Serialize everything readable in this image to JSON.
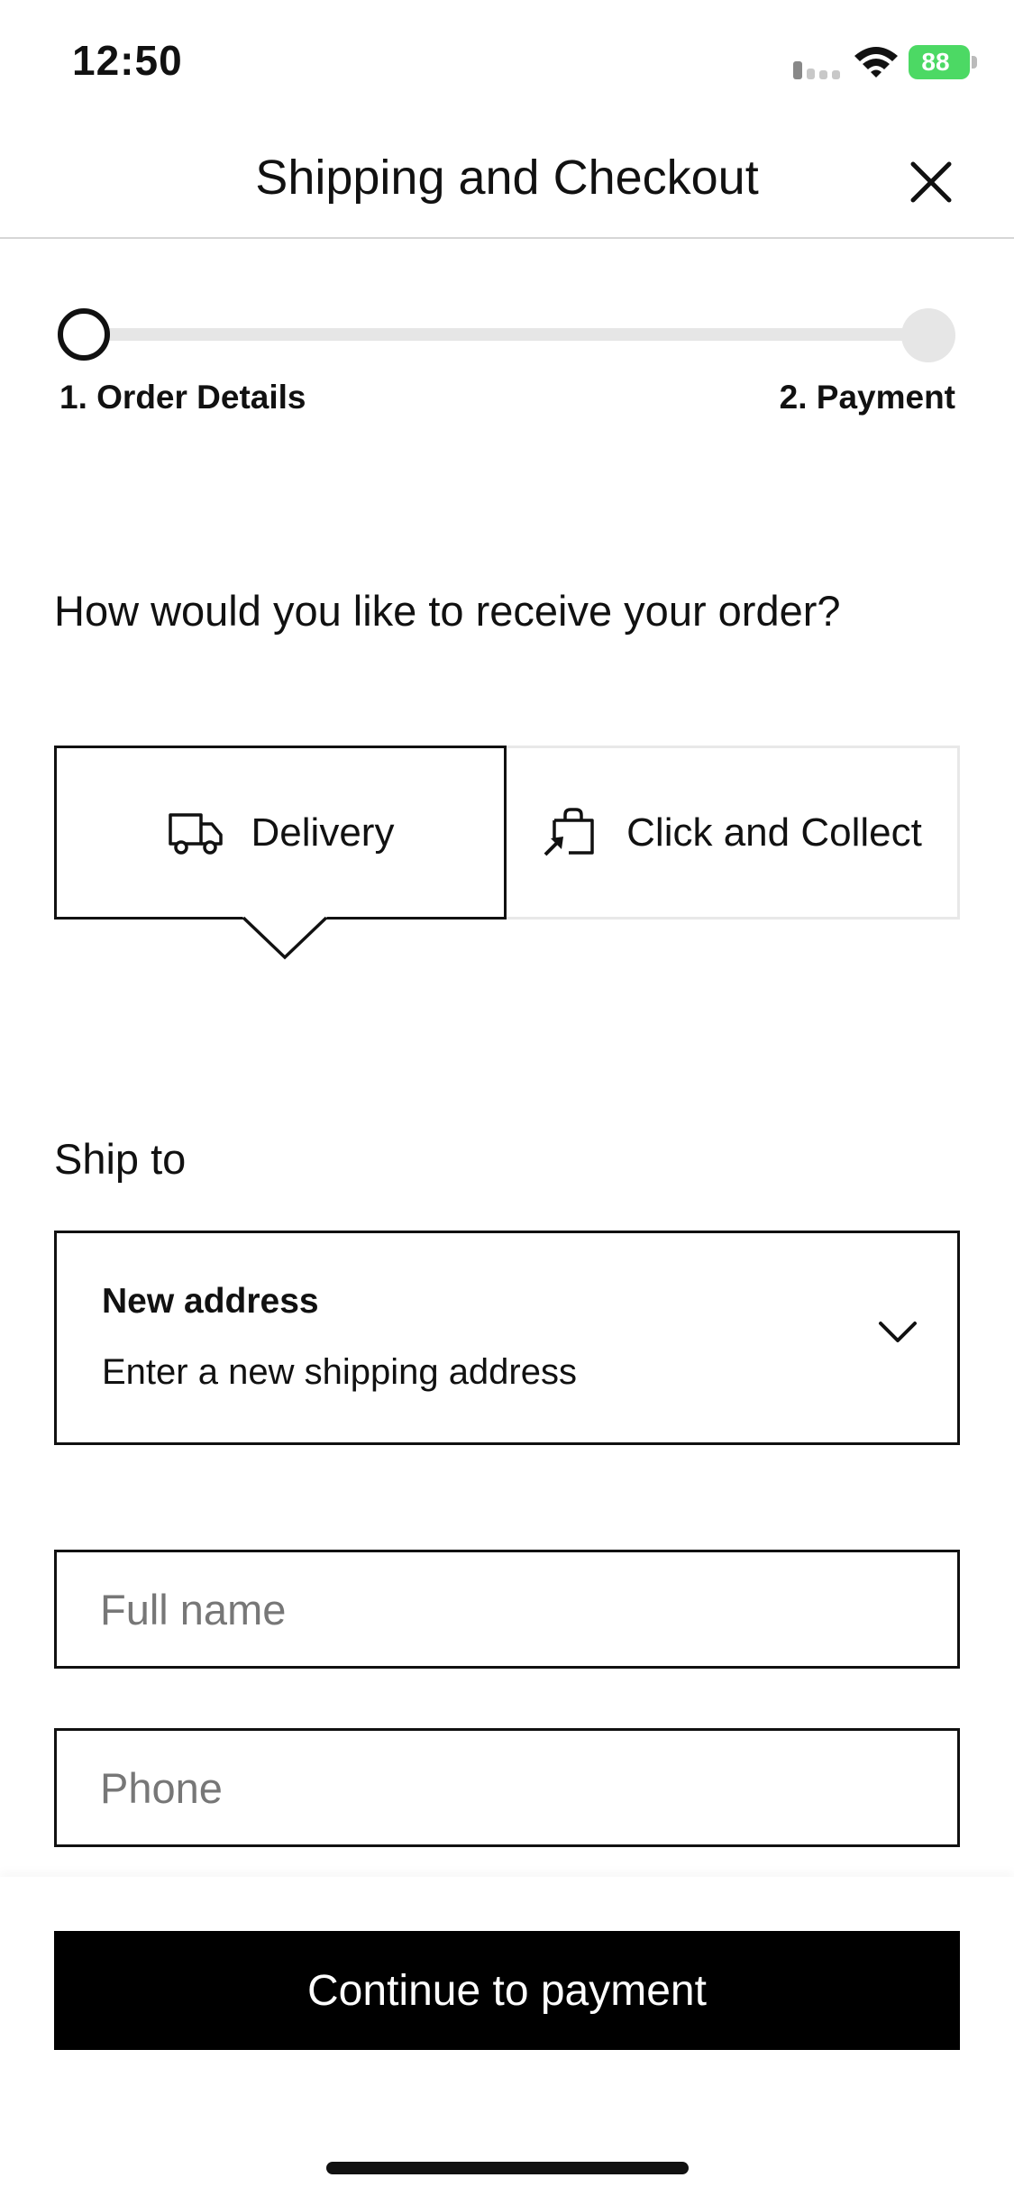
{
  "status_bar": {
    "time": "12:50",
    "battery_level": "88",
    "battery_color": "#4cd964"
  },
  "header": {
    "title": "Shipping and Checkout",
    "close_icon": "close-icon"
  },
  "progress": {
    "steps": [
      {
        "label": "1. Order Details",
        "state": "current"
      },
      {
        "label": "2. Payment",
        "state": "upcoming"
      }
    ]
  },
  "receive": {
    "question": "How would you like to receive your order?",
    "options": [
      {
        "label": "Delivery",
        "icon": "truck-icon",
        "selected": true
      },
      {
        "label": "Click and Collect",
        "icon": "shopping-bag-icon",
        "selected": false
      }
    ]
  },
  "ship_to": {
    "label": "Ship to",
    "selected_title": "New address",
    "selected_subtitle": "Enter a new shipping address",
    "chevron_icon": "chevron-down-icon"
  },
  "form": {
    "full_name": {
      "value": "",
      "placeholder": "Full name"
    },
    "phone": {
      "value": "",
      "placeholder": "Phone"
    }
  },
  "footer": {
    "continue_label": "Continue to payment"
  },
  "colors": {
    "primary": "#000000",
    "border_inactive": "#e8e8e8",
    "progress_track": "#e6e6e6"
  }
}
